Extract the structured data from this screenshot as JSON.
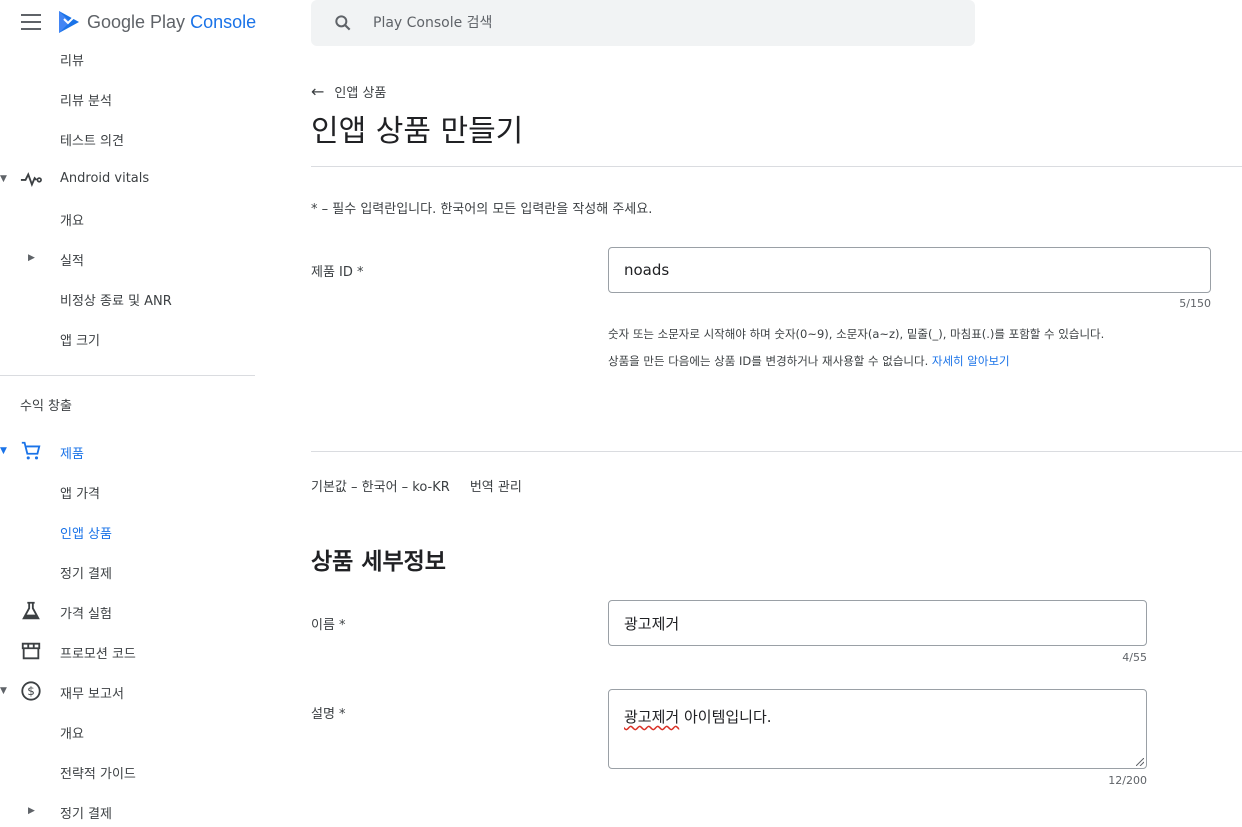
{
  "header": {
    "logo_text_main": "Google Play",
    "logo_text_accent": "Console",
    "search_placeholder": "Play Console 검색"
  },
  "sidebar": {
    "items": [
      {
        "label": "리뷰"
      },
      {
        "label": "리뷰 분석"
      },
      {
        "label": "테스트 의견"
      },
      {
        "label": "Android vitals"
      },
      {
        "label": "개요"
      },
      {
        "label": "실적"
      },
      {
        "label": "비정상 종료 및 ANR"
      },
      {
        "label": "앱 크기"
      },
      {
        "label": "수익 창출"
      },
      {
        "label": "제품"
      },
      {
        "label": "앱 가격"
      },
      {
        "label": "인앱 상품"
      },
      {
        "label": "정기 결제"
      },
      {
        "label": "가격 실험"
      },
      {
        "label": "프로모션 코드"
      },
      {
        "label": "재무 보고서"
      },
      {
        "label": "개요"
      },
      {
        "label": "전략적 가이드"
      },
      {
        "label": "정기 결제"
      }
    ],
    "active_color": "#1a73e8"
  },
  "main": {
    "back_label": "인앱 상품",
    "title": "인앱 상품 만들기",
    "required_note": "* – 필수 입력란입니다. 한국어의 모든 입력란을 작성해 주세요.",
    "product_id": {
      "label": "제품 ID *",
      "value": "noads",
      "counter": "5/150",
      "help_1": "숫자 또는 소문자로 시작해야 하며 숫자(0~9), 소문자(a~z), 밑줄(_), 마침표(.)를 포함할 수 있습니다.",
      "help_2": "상품을 만든 다음에는 상품 ID를 변경하거나 재사용할 수 없습니다.",
      "help_link": "자세히 알아보기"
    },
    "language": {
      "default_label": "기본값 – 한국어 – ko-KR",
      "manage_label": "번역 관리"
    },
    "details": {
      "section_title": "상품 세부정보",
      "name_label": "이름 *",
      "name_value": "광고제거",
      "name_counter": "4/55",
      "desc_label": "설명 *",
      "desc_value_underlined": "광고제거",
      "desc_value_rest": " 아이템입니다.",
      "desc_counter": "12/200"
    }
  }
}
